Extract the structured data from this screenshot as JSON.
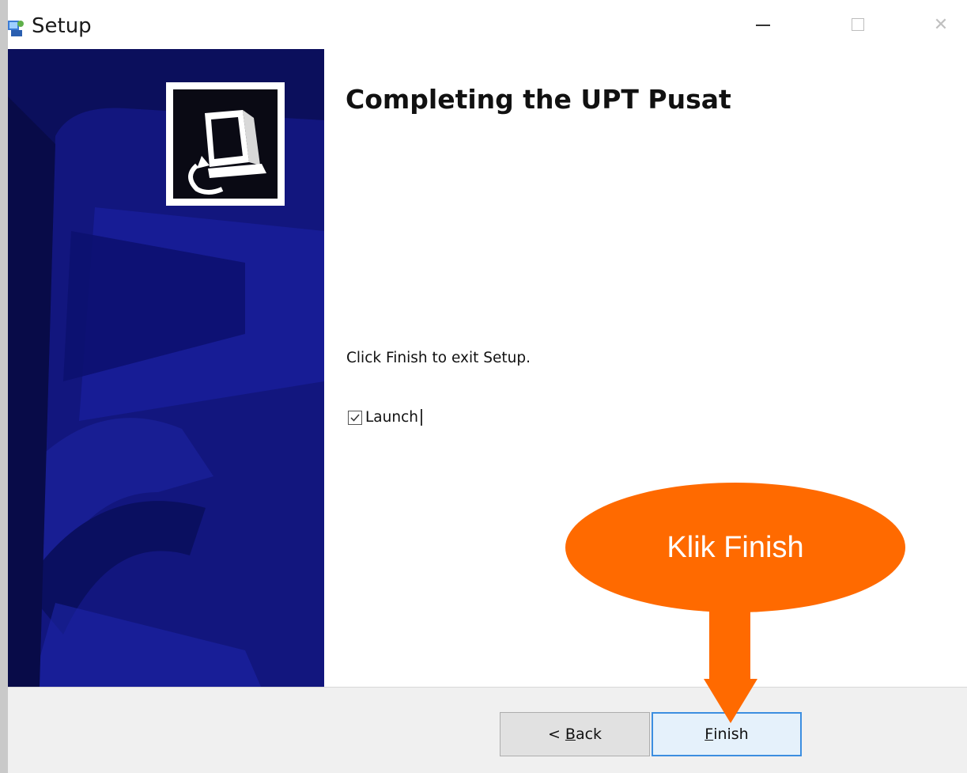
{
  "window": {
    "title": "Setup",
    "controls": {
      "minimize": "—",
      "maximize": "☐",
      "close": "✕"
    }
  },
  "content": {
    "heading": "Completing the UPT Pusat",
    "instruction": "Click Finish to exit Setup.",
    "launch_checkbox": {
      "label": "Launch",
      "checked": true
    }
  },
  "buttons": {
    "back": {
      "prefix": "< ",
      "accel": "B",
      "rest": "ack"
    },
    "finish": {
      "accel": "F",
      "rest": "inish"
    }
  },
  "annotation": {
    "callout_text": "Klik Finish",
    "color": "#ff6a00"
  },
  "colors": {
    "banner_bg": "#0b0f5c",
    "button_bar_bg": "#f0f0f0",
    "focus_border": "#3c8ee0"
  },
  "icons": {
    "app": "installer-icon",
    "banner": "installer-computer-icon"
  }
}
